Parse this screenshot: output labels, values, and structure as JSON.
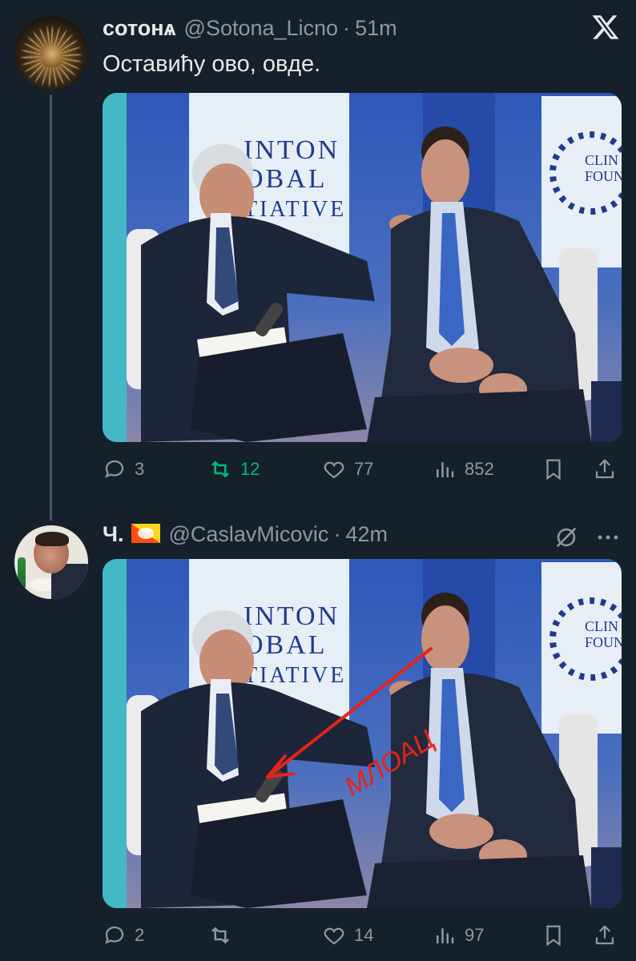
{
  "tweets": [
    {
      "display_name": "сотонѧ",
      "handle": "@Sotona_Licno",
      "separator": "·",
      "time": "51m",
      "text": "Оставићу ово, овде.",
      "image": {
        "backdrop_words": [
          "INTON",
          "OBAL",
          "TIATIVE",
          "CLIN",
          "FOUN"
        ]
      },
      "stats": {
        "replies": "3",
        "reposts": "12",
        "likes": "77",
        "views": "852"
      },
      "reposted_by_viewer": true,
      "corner_icon": "x-logo-icon"
    },
    {
      "display_name": "Ч.",
      "flag": "bhutan-flag",
      "handle": "@CaslavMicovic",
      "separator": "·",
      "time": "42m",
      "text": "",
      "image": {
        "backdrop_words": [
          "INTON",
          "OBAL",
          "TIATIVE",
          "CLIN",
          "FOUN"
        ],
        "annotation_text": "МЛОАЦ",
        "annotation_color": "#e8221b"
      },
      "stats": {
        "replies": "2",
        "reposts": "",
        "likes": "14",
        "views": "97"
      },
      "reposted_by_viewer": false,
      "header_icons": [
        "mute-icon",
        "more-icon"
      ]
    }
  ],
  "colors": {
    "background": "#15202b",
    "text": "#e7e9ea",
    "secondary": "#8b98a5",
    "repost_active": "#00ba7c",
    "thread_line": "#425466"
  }
}
